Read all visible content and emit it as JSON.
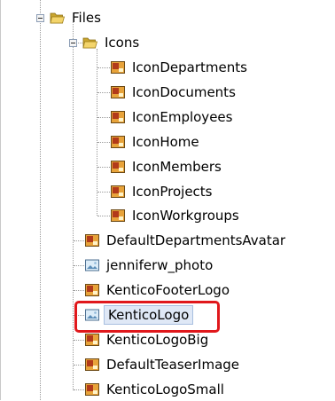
{
  "tree": {
    "files": {
      "label": "Files",
      "expanded": true,
      "icon": "folder-open-icon"
    },
    "icons_folder": {
      "label": "Icons",
      "expanded": true,
      "icon": "folder-open-icon"
    },
    "icon_files": [
      {
        "label": "IconDepartments",
        "icon": "image-file-icon"
      },
      {
        "label": "IconDocuments",
        "icon": "image-file-icon"
      },
      {
        "label": "IconEmployees",
        "icon": "image-file-icon"
      },
      {
        "label": "IconHome",
        "icon": "image-file-icon"
      },
      {
        "label": "IconMembers",
        "icon": "image-file-icon"
      },
      {
        "label": "IconProjects",
        "icon": "image-file-icon"
      },
      {
        "label": "IconWorkgroups",
        "icon": "image-file-icon"
      }
    ],
    "files_items": [
      {
        "label": "DefaultDepartmentsAvatar",
        "icon": "image-file-icon"
      },
      {
        "label": "jenniferw_photo",
        "icon": "photo-file-icon"
      },
      {
        "label": "KenticoFooterLogo",
        "icon": "image-file-icon"
      },
      {
        "label": "KenticoLogo",
        "icon": "photo-file-icon",
        "selected": true
      },
      {
        "label": "KenticoLogoBig",
        "icon": "image-file-icon"
      },
      {
        "label": "DefaultTeaserImage",
        "icon": "image-file-icon"
      },
      {
        "label": "KenticoLogoSmall",
        "icon": "image-file-icon"
      }
    ]
  },
  "colors": {
    "highlight_border": "#e0181c",
    "selection_background": "#dfe8f6"
  }
}
